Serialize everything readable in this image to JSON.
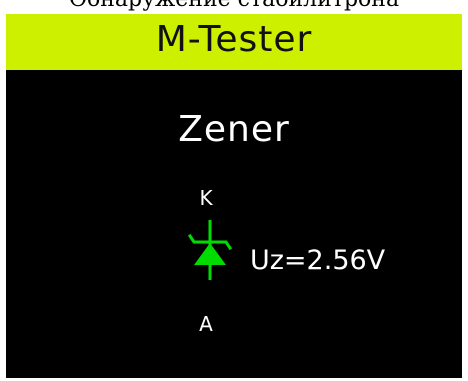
{
  "caption": "Обнаружение стабилитрона",
  "screen": {
    "title": "M-Tester",
    "mode": "Zener",
    "component": {
      "type": "zener-diode",
      "pin_top": "K",
      "pin_bottom": "A",
      "measurement": "Uz=2.56V",
      "symbol_color": "#00dc00"
    }
  },
  "colors": {
    "title_bar": "#ccf000",
    "background": "#000000",
    "text": "#ffffff"
  }
}
